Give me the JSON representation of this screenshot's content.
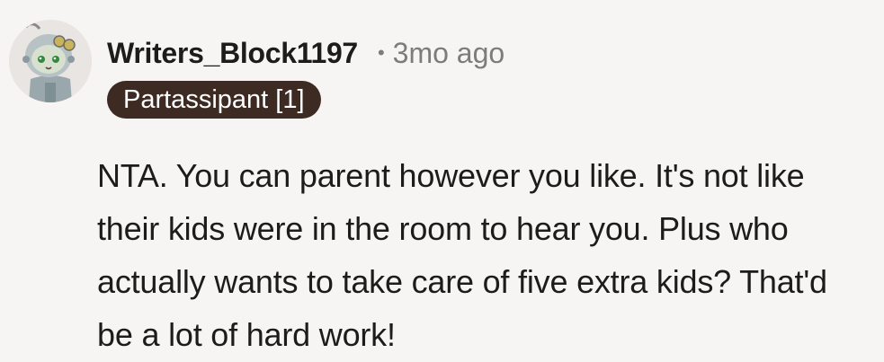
{
  "comment": {
    "author": "Writers_Block1197",
    "separator": "•",
    "timestamp": "3mo ago",
    "flair": "Partassipant [1]",
    "text": "NTA. You can parent however you like. It's not like their kids were in the room to hear you. Plus who actually wants to take care of five extra kids? That'd be a lot of hard work!",
    "avatar_icon": "robot-avatar-icon"
  },
  "colors": {
    "background": "#f7f5f4",
    "flair_background": "#3d2a22",
    "meta_text": "#7c7c7c",
    "primary_text": "#1c1c1c"
  }
}
